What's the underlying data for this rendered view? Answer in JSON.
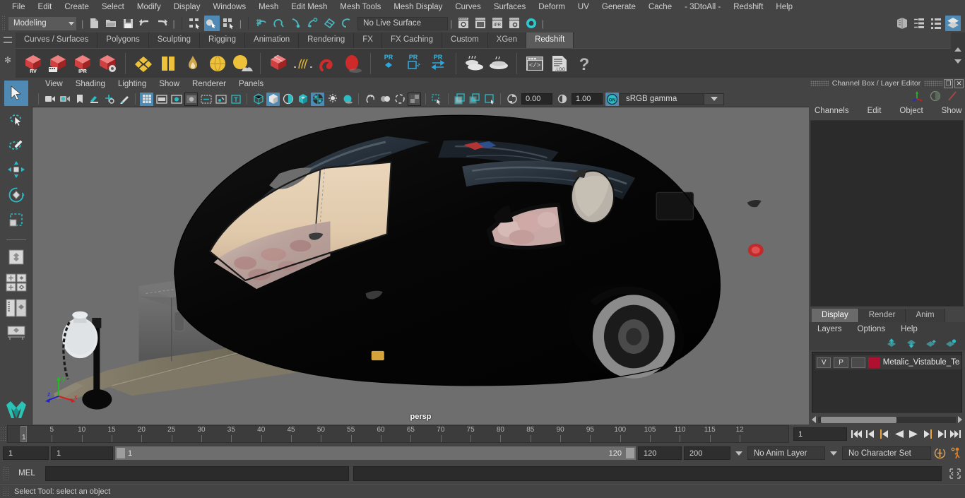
{
  "app": {
    "menubar": [
      "File",
      "Edit",
      "Create",
      "Select",
      "Modify",
      "Display",
      "Windows",
      "Mesh",
      "Edit Mesh",
      "Mesh Tools",
      "Mesh Display",
      "Curves",
      "Surfaces",
      "Deform",
      "UV",
      "Generate",
      "Cache",
      "- 3DtoAll -",
      "Redshift",
      "Help"
    ]
  },
  "statusbar": {
    "mode": "Modeling",
    "live_surface": "No Live Surface",
    "icons": [
      "new-scene-icon",
      "open-scene-icon",
      "save-scene-icon",
      "undo-icon",
      "redo-icon",
      "select-hierarchy-icon",
      "select-object-icon",
      "select-component-icon",
      "snap-grid-icon",
      "snap-curve-icon",
      "snap-point-icon",
      "snap-projected-center-icon",
      "snap-view-plane-icon",
      "make-live-icon",
      "render-view-icon",
      "render-current-frame-icon",
      "ipr-render-icon",
      "render-settings-icon",
      "hypershade-icon",
      "show-channel-box-icon",
      "show-attribute-editor-icon",
      "show-tool-settings-icon",
      "show-modeling-toolkit-icon"
    ]
  },
  "shelf": {
    "tabs": [
      "Curves / Surfaces",
      "Polygons",
      "Sculpting",
      "Rigging",
      "Animation",
      "Rendering",
      "FX",
      "FX Caching",
      "Custom",
      "XGen",
      "Redshift"
    ],
    "selected": "Redshift",
    "items": [
      "redshift-render-view-icon",
      "redshift-render-sequence-icon",
      "redshift-ipr-icon",
      "redshift-render-settings-icon",
      "redshift-material-icon",
      "redshift-ramp-icon",
      "redshift-ambient-occlusion-icon",
      "redshift-sphere-light-icon",
      "redshift-dome-light-icon",
      "redshift-proxy-icon",
      "redshift-hair-icon",
      "redshift-volume-icon",
      "redshift-object-icon",
      "redshift-pr-bifrost-icon",
      "redshift-pr-export-icon",
      "redshift-pr-transfer-icon",
      "redshift-bake-icon",
      "redshift-bake-set-icon",
      "redshift-script-editor-icon",
      "redshift-log-icon",
      "redshift-help-icon"
    ]
  },
  "toolbox": {
    "items": [
      "select-tool",
      "lasso-select-tool",
      "paint-select-tool",
      "move-tool",
      "rotate-tool",
      "scale-tool",
      "last-tool-used",
      "quick-layout-single",
      "quick-layout-four",
      "quick-layout-outliner-persp",
      "quick-layout-hypershade",
      "maya-logo"
    ],
    "selected": "select-tool"
  },
  "viewport": {
    "menus": [
      "View",
      "Shading",
      "Lighting",
      "Show",
      "Renderer",
      "Panels"
    ],
    "toolbar_icons": [
      "select-camera-icon",
      "camera-attributes-icon",
      "bookmark-icon",
      "image-plane-icon",
      "2d-pan-zoom-icon",
      "grease-pencil-icon",
      "grid-toggle-icon",
      "film-gate-icon",
      "resolution-gate-icon",
      "gate-mask-icon",
      "film-origin-icon",
      "exposure-icon",
      "xray-text-icon",
      "wireframe-icon",
      "smooth-shade-icon",
      "shaded-wireframe-icon",
      "use-default-material-icon",
      "textured-icon",
      "use-all-lights-icon",
      "shadows-icon",
      "screen-space-ao-icon",
      "motion-blur-icon",
      "multisample-icon",
      "depth-peel-icon",
      "xray-icon",
      "xray-joints-icon",
      "xray-active-components-icon",
      "isolate-select-icon",
      "view-transform-icon"
    ],
    "exposure": "0.00",
    "gamma": "1.00",
    "color_space": "sRGB gamma",
    "camera_label": "persp",
    "background_color": "#6e6e6e",
    "axis_labels": [
      "x",
      "y",
      "z"
    ],
    "axis_colors": {
      "x": "#cc2222",
      "y": "#22bb22",
      "z": "#2222cc"
    },
    "scene": {
      "object": "Metalic_Vistabule_Teardrop_Trailer",
      "body_color": "#070707",
      "floor_color": "#7b7463",
      "cooler_color": "#666666",
      "window_color": "#e2cbb0",
      "tire_color": "#8d8d8d",
      "taillight_color": "#c22b2b"
    }
  },
  "channel_box": {
    "title": "Channel Box / Layer Editor",
    "header_icons": [
      "axis-gizmo-icon",
      "channel-filter-icon",
      "no-anim-icon"
    ],
    "window_buttons": [
      "restore-icon",
      "close-icon"
    ],
    "menus": [
      "Channels",
      "Edit",
      "Object",
      "Show"
    ]
  },
  "layer_editor": {
    "tabs": [
      "Display",
      "Render",
      "Anim"
    ],
    "selected_tab": "Display",
    "menus": [
      "Layers",
      "Options",
      "Help"
    ],
    "tool_icons": [
      "move-layer-up-icon",
      "move-layer-down-icon",
      "new-layer-from-selected-icon",
      "new-layer-icon"
    ],
    "layers": [
      {
        "visibility": "V",
        "playback": "P",
        "shading": "",
        "color": "#b0102f",
        "name": "Metalic_Vistabule_Tear"
      }
    ]
  },
  "timeline": {
    "start_label": "1",
    "tick_labels": [
      "5",
      "10",
      "15",
      "20",
      "25",
      "30",
      "35",
      "40",
      "45",
      "50",
      "55",
      "60",
      "65",
      "70",
      "75",
      "80",
      "85",
      "90",
      "95",
      "100",
      "105",
      "110",
      "115",
      "12"
    ],
    "current_frame": "1",
    "transport_icons": [
      "go-to-start-icon",
      "step-back-key-icon",
      "step-back-frame-icon",
      "play-backwards-icon",
      "play-forwards-icon",
      "step-forward-frame-icon",
      "step-forward-key-icon",
      "go-to-end-icon"
    ]
  },
  "range": {
    "anim_start": "1",
    "range_start": "1",
    "slider_min": "1",
    "slider_max": "120",
    "range_end": "120",
    "anim_end": "200",
    "anim_layer": "No Anim Layer",
    "character_set": "No Character Set",
    "right_icons": [
      "animation-preferences-icon",
      "character-set-icon"
    ]
  },
  "command_line": {
    "language": "MEL",
    "input_value": "",
    "output_value": "",
    "script_editor_icon": "script-editor-icon"
  },
  "help_line": {
    "text": "Select Tool: select an object"
  }
}
